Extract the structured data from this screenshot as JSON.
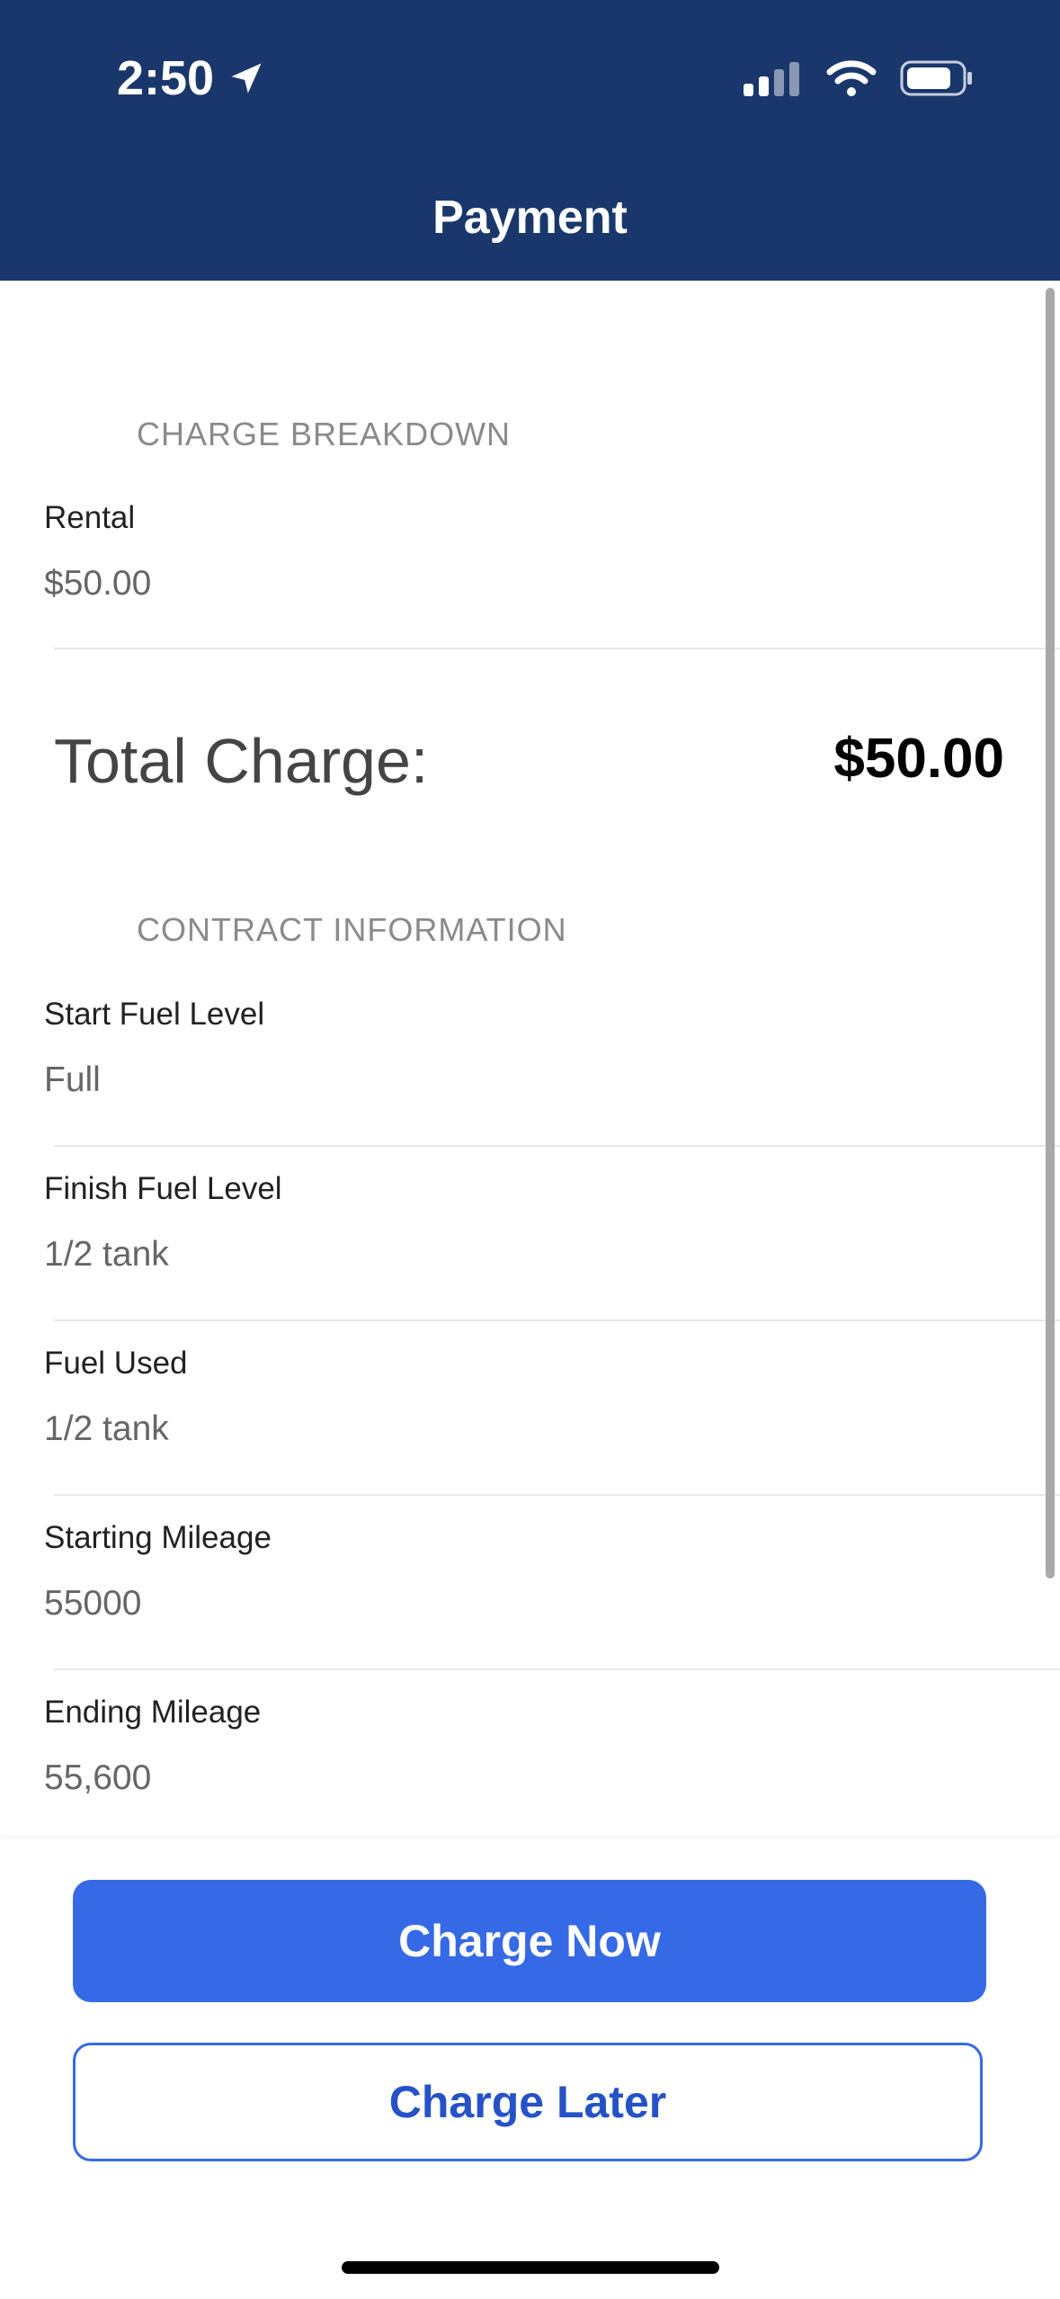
{
  "status_bar": {
    "time": "2:50"
  },
  "nav": {
    "title": "Payment"
  },
  "charge_breakdown": {
    "header": "CHARGE BREAKDOWN",
    "items": [
      {
        "label": "Rental",
        "value": "$50.00"
      }
    ]
  },
  "total": {
    "label": "Total Charge:",
    "value": "$50.00"
  },
  "contract_information": {
    "header": "CONTRACT INFORMATION",
    "items": [
      {
        "label": "Start Fuel Level",
        "value": "Full"
      },
      {
        "label": "Finish Fuel Level",
        "value": "1/2 tank"
      },
      {
        "label": "Fuel Used",
        "value": "1/2 tank"
      },
      {
        "label": "Starting Mileage",
        "value": "55000"
      },
      {
        "label": "Ending Mileage",
        "value": "55,600"
      }
    ]
  },
  "actions": {
    "charge_now": "Charge Now",
    "charge_later": "Charge Later"
  },
  "colors": {
    "header_bg": "#1a376c",
    "primary": "#3569e6"
  }
}
